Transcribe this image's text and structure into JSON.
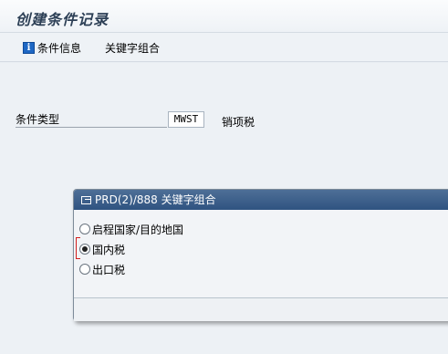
{
  "window": {
    "title": "创建条件记录"
  },
  "toolbar": {
    "items": [
      {
        "label": "条件信息",
        "icon": "info-icon"
      },
      {
        "label": "关键字组合"
      }
    ]
  },
  "form": {
    "condition_type_label": "条件类型",
    "condition_type_value": "MWST",
    "condition_type_desc": "销项税"
  },
  "dialog": {
    "title": "PRD(2)/888 关键字组合",
    "options": [
      {
        "label": "启程国家/目的地国",
        "selected": false
      },
      {
        "label": "国内税",
        "selected": true
      },
      {
        "label": "出口税",
        "selected": false
      }
    ]
  },
  "colors": {
    "dialog_header": "#3a5d8a",
    "title_text": "#2c3f55",
    "required_marker": "#d21e1e"
  }
}
